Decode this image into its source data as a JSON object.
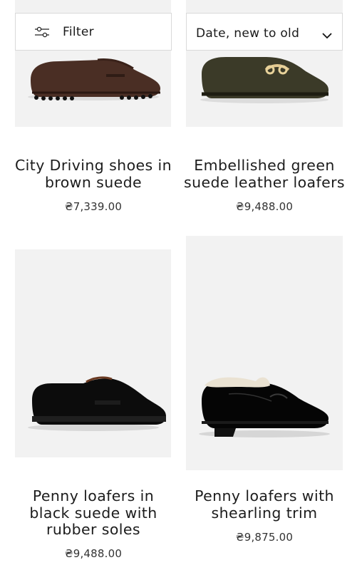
{
  "controls": {
    "filter_label": "Filter",
    "sort_label": "Date, new to old"
  },
  "products": [
    {
      "title_line1": "City Driving shoes in",
      "title_line2": "brown suede",
      "price": "₴7,339.00"
    },
    {
      "title_line1": "Embellished green",
      "title_line2": "suede leather loafers",
      "price": "₴9,488.00"
    },
    {
      "title_line1": "Penny loafers in",
      "title_line2": "black suede with",
      "title_line3": "rubber soles",
      "price": "₴9,488.00"
    },
    {
      "title_line1": "Penny loafers with",
      "title_line2": "shearling trim",
      "price": "₴9,875.00"
    }
  ]
}
